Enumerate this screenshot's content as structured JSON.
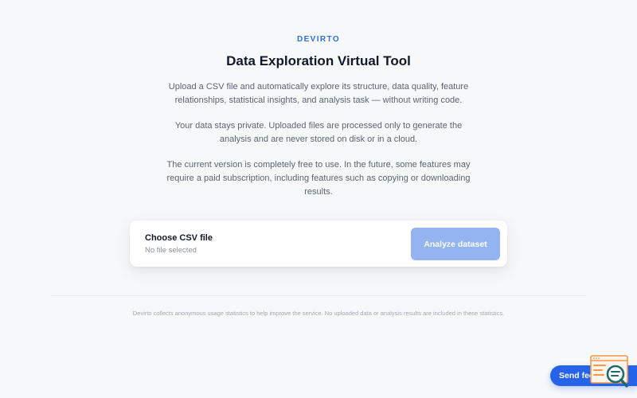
{
  "app": {
    "brand": "DEVIRTO",
    "title": "Data Exploration Virtual Tool"
  },
  "intro": {
    "paragraph_1": "Upload a CSV file and automatically explore its structure, data quality, feature relationships, statistical insights, and analysis task — without writing code.",
    "paragraph_2": "Your data stays private. Uploaded files are processed only to generate the analysis and are never stored on disk or in a cloud.",
    "paragraph_3": "The current version is completely free to use. In the future, some features may require a paid subscription, including features such as copying or downloading results."
  },
  "upload": {
    "choose_label": "Choose CSV file",
    "file_status": "No file selected",
    "analyze_label": "Analyze dataset"
  },
  "footer": {
    "notice": "Devirto collects anonymous usage statistics to help improve the service. No uploaded data or analysis results are included in these statistics."
  },
  "feedback": {
    "label": "Send feedback",
    "icon": "magnifier-chart-icon"
  },
  "colors": {
    "accent": "#2f6fd6",
    "button_disabled": "#93b3f1",
    "feedback_button": "#2563eb",
    "icon_orange": "#f29a4a",
    "icon_teal": "#1c6b6e"
  }
}
